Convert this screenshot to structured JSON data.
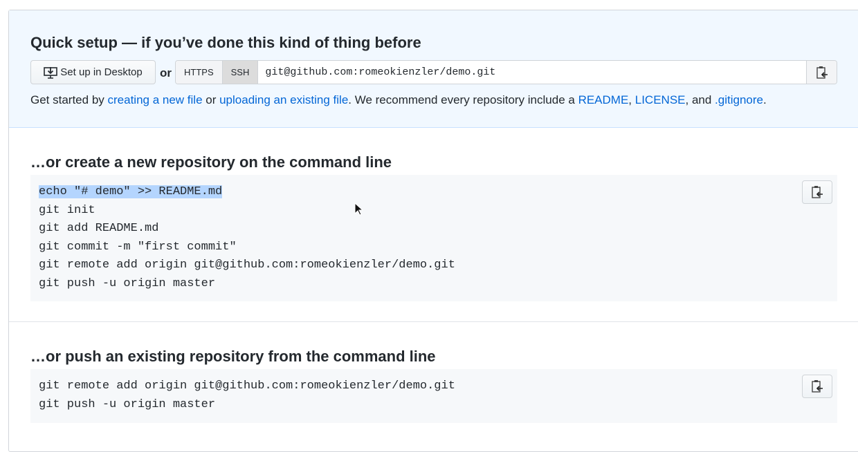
{
  "quick_setup": {
    "title": "Quick setup — if you’ve done this kind of thing before",
    "desktop_button": "Set up in Desktop",
    "or": "or",
    "https": "HTTPS",
    "ssh": "SSH",
    "url": "git@github.com:romeokienzler/demo.git",
    "desc": {
      "t1": "Get started by ",
      "l1": "creating a new file",
      "t2": " or ",
      "l2": "uploading an existing file",
      "t3": ". We recommend every repository include a ",
      "l3": "README",
      "t4": ", ",
      "l4": "LICENSE",
      "t5": ", and ",
      "l5": ".gitignore",
      "t6": "."
    }
  },
  "new_repo": {
    "title": "…or create a new repository on the command line",
    "lines": [
      "echo \"# demo\" >> README.md",
      "git init",
      "git add README.md",
      "git commit -m \"first commit\"",
      "git remote add origin git@github.com:romeokienzler/demo.git",
      "git push -u origin master"
    ]
  },
  "push_repo": {
    "title": "…or push an existing repository from the command line",
    "lines": [
      "git remote add origin git@github.com:romeokienzler/demo.git",
      "git push -u origin master"
    ]
  }
}
